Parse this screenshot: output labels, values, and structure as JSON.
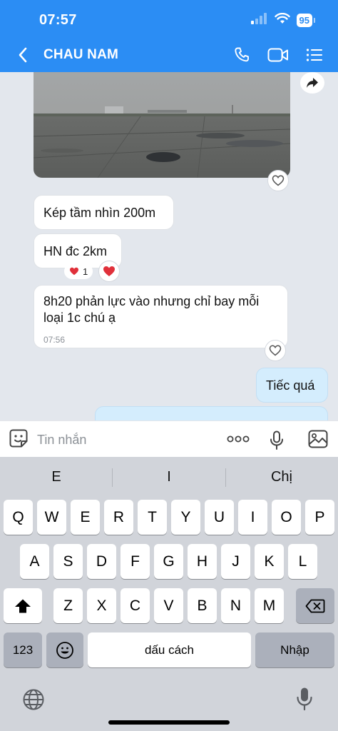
{
  "status_bar": {
    "time": "07:57",
    "battery": "95"
  },
  "header": {
    "title": "CHAU NAM"
  },
  "messages": [
    {
      "text": "Kép tầm nhìn 200m"
    },
    {
      "text": "HN đc 2km",
      "reaction_count": "1"
    },
    {
      "text": "8h20 phản lực vào nhưng chỉ bay mỗi loại 1c chú ạ",
      "time": "07:56"
    },
    {
      "text": "Tiếc quá"
    }
  ],
  "composer": {
    "placeholder": "Tin nhắn"
  },
  "keyboard": {
    "suggestions": [
      "E",
      "I",
      "Chị"
    ],
    "row1": [
      "Q",
      "W",
      "E",
      "R",
      "T",
      "Y",
      "U",
      "I",
      "O",
      "P"
    ],
    "row2": [
      "A",
      "S",
      "D",
      "F",
      "G",
      "H",
      "J",
      "K",
      "L"
    ],
    "row3": [
      "Z",
      "X",
      "C",
      "V",
      "B",
      "N",
      "M"
    ],
    "numbers_key": "123",
    "space_key": "dấu cách",
    "return_key": "Nhập"
  },
  "colors": {
    "header": "#2b8df4",
    "my_bubble": "#d4edfd",
    "keyboard": "#d1d4da"
  },
  "icons": [
    "back-icon",
    "phone-icon",
    "video-call-icon",
    "list-menu-icon",
    "forward-icon",
    "heart-icon",
    "sticker-icon",
    "more-icon",
    "mic-icon",
    "image-icon",
    "shift-icon",
    "delete-icon",
    "emoji-icon",
    "globe-icon",
    "dictation-mic-icon"
  ]
}
